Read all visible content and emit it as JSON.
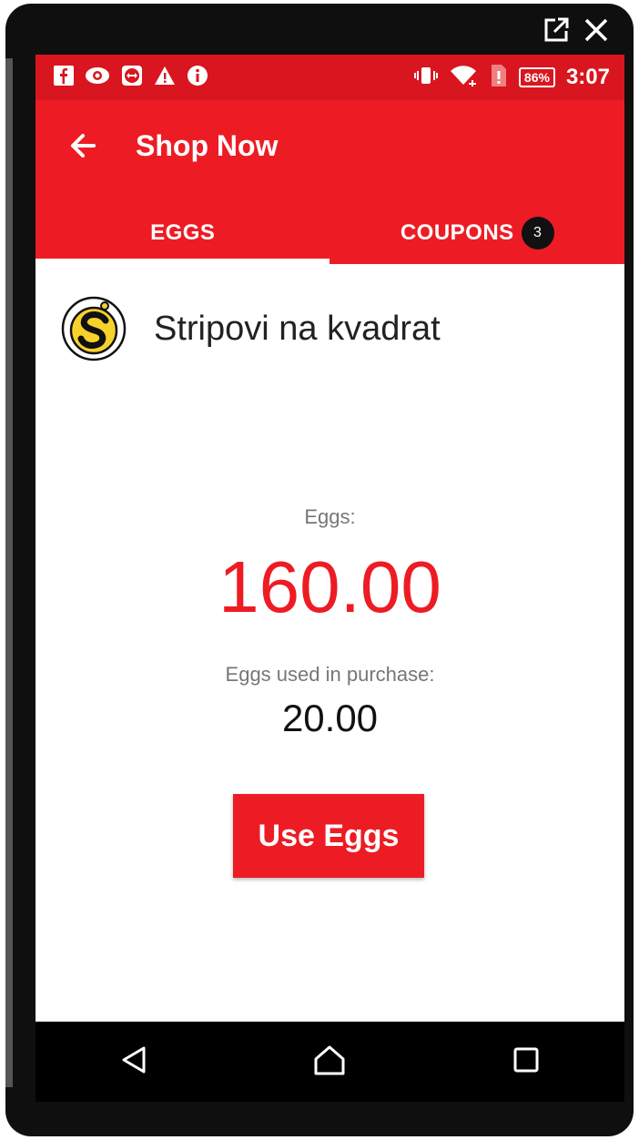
{
  "status_bar": {
    "time": "3:07",
    "battery": "86%",
    "left_icons": [
      "facebook-icon",
      "eye-icon",
      "teamviewer-icon",
      "warning-icon",
      "info-icon"
    ],
    "right_icons": [
      "vibrate-icon",
      "wifi-icon",
      "sim-icon",
      "battery-icon"
    ]
  },
  "app_bar": {
    "title": "Shop Now",
    "back_icon": "arrow-left-icon"
  },
  "tabs": [
    {
      "label": "EGGS",
      "active": true
    },
    {
      "label": "COUPONS",
      "badge": "3"
    }
  ],
  "merchant": {
    "name": "Stripovi na kvadrat"
  },
  "eggs": {
    "label": "Eggs:",
    "value": "160.00"
  },
  "purchase": {
    "label": "Eggs used in purchase:",
    "value": "20.00"
  },
  "use_button": {
    "label": "Use Eggs"
  },
  "colors": {
    "accent": "#ed1c24",
    "status_bar": "#d9161f",
    "nav_bar": "#000000"
  }
}
